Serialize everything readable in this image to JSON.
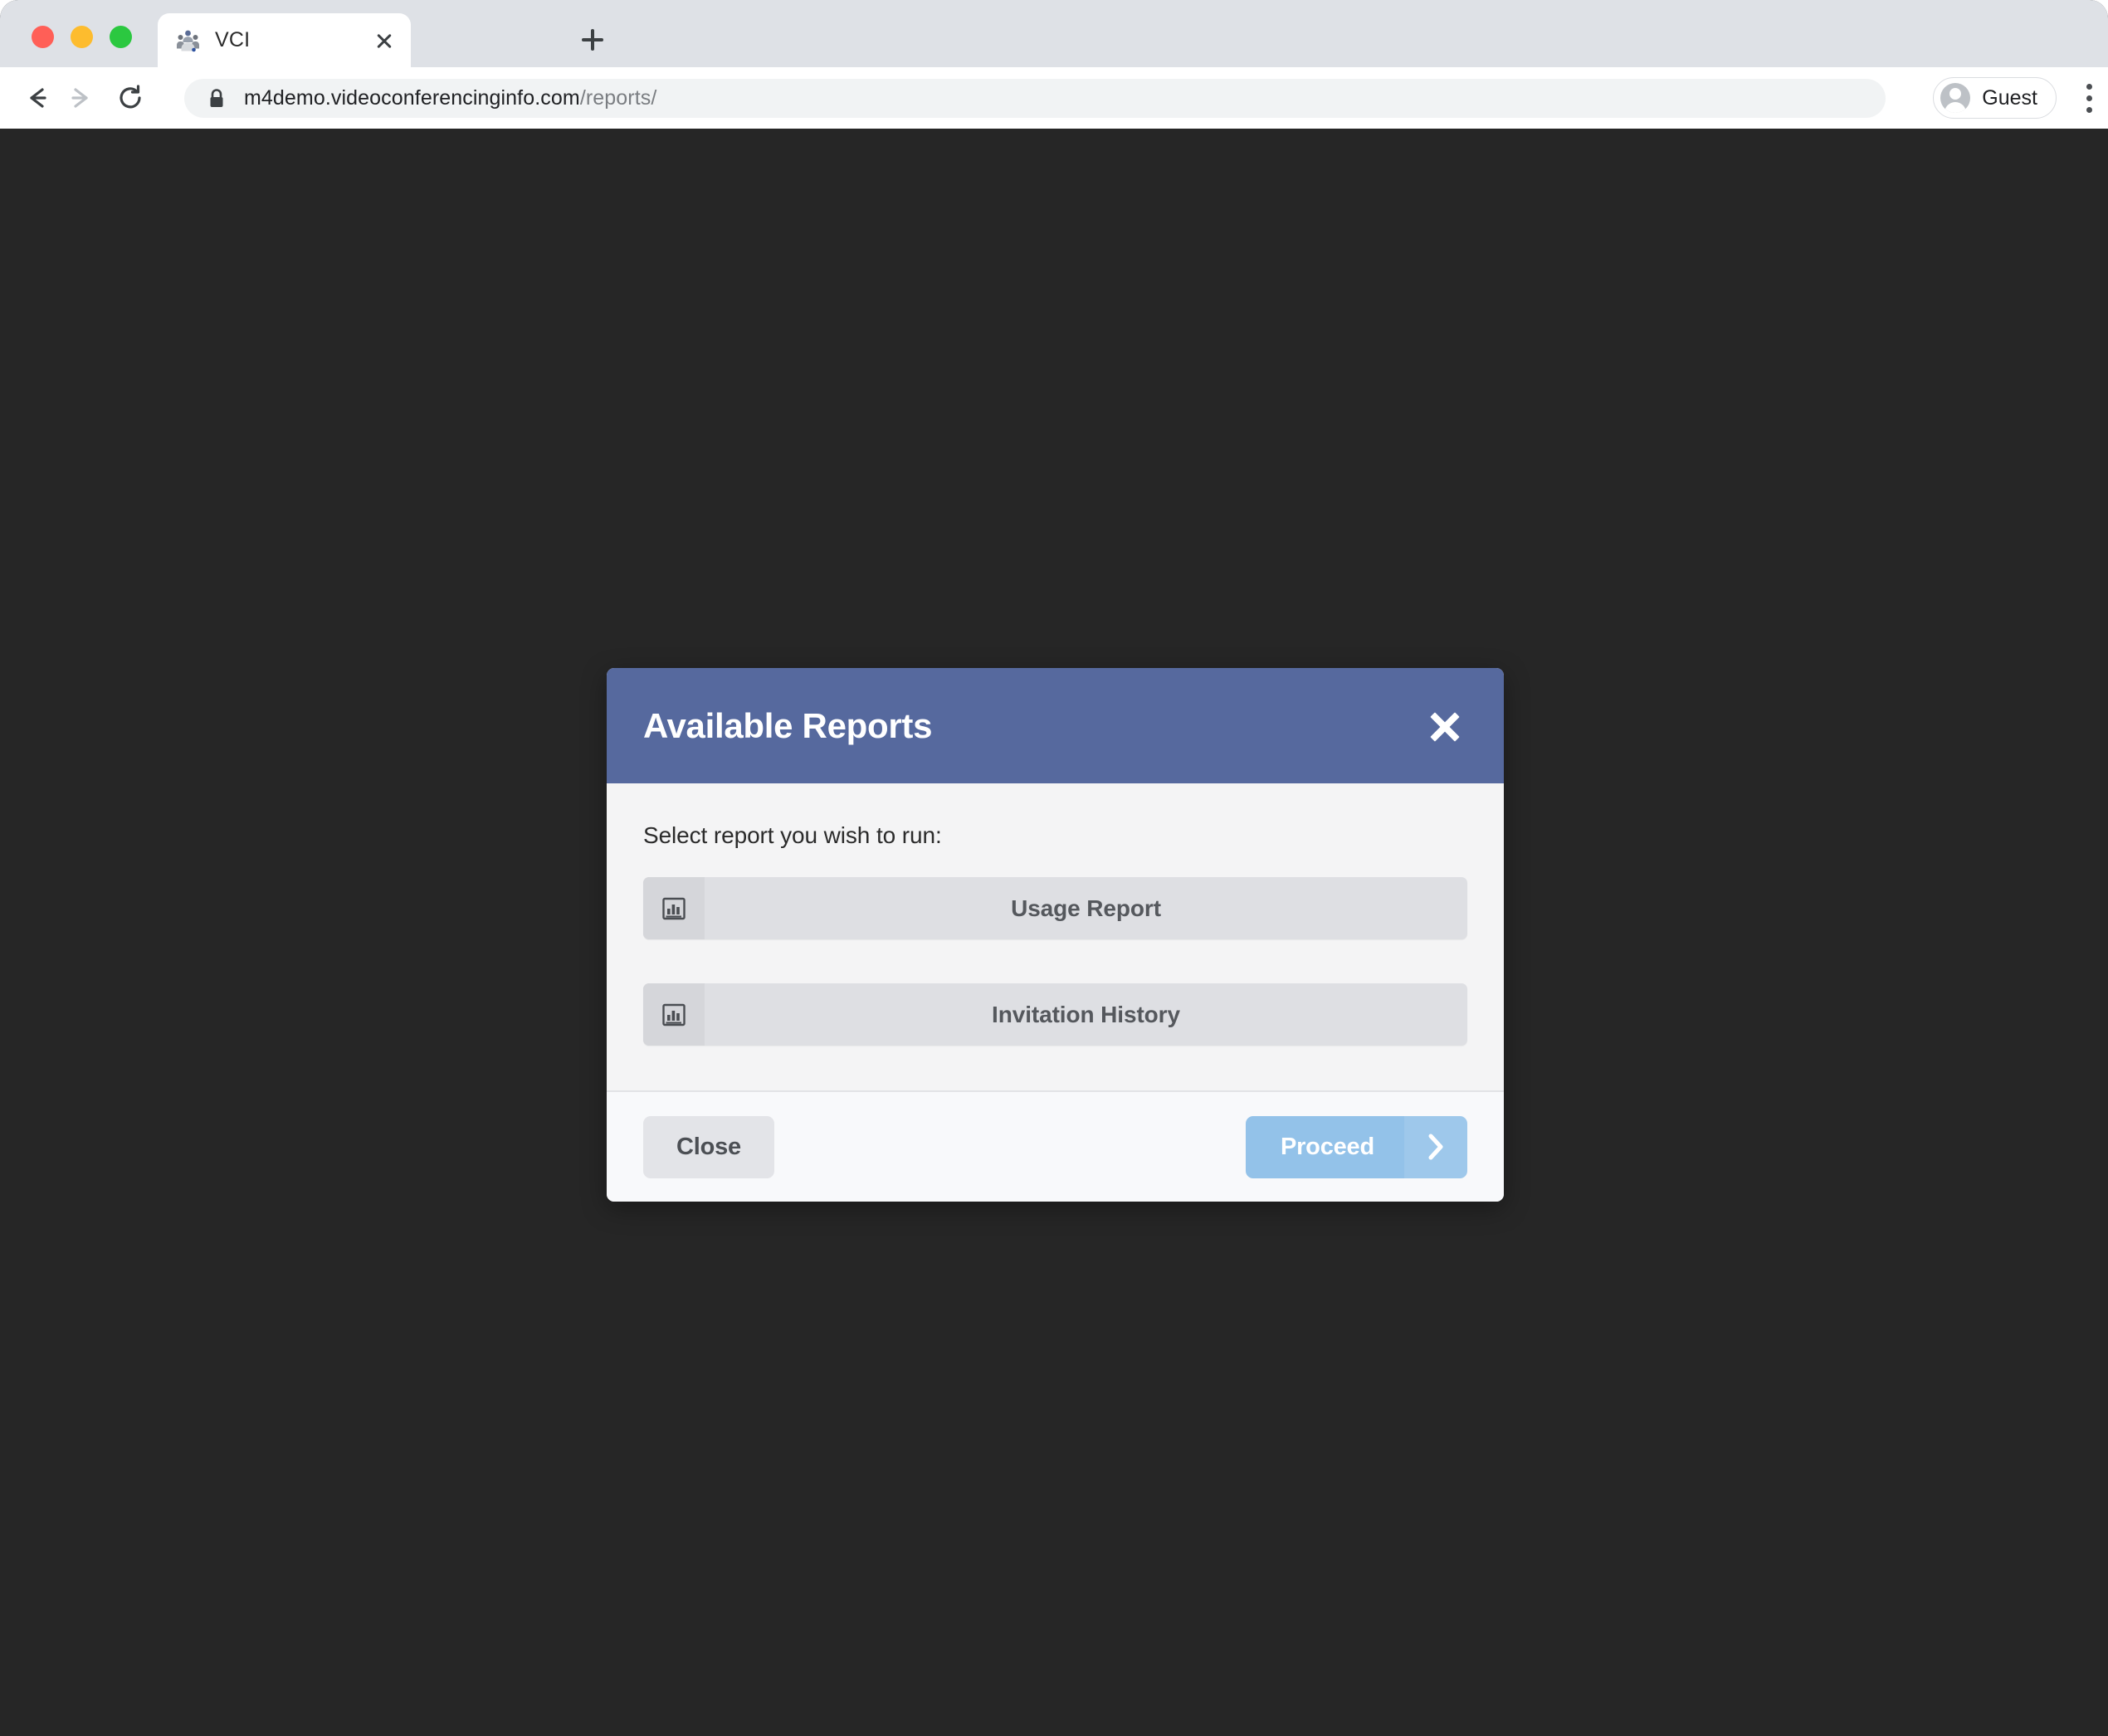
{
  "browser": {
    "tab": {
      "title": "VCI",
      "favicon": "people-group-icon",
      "close_icon": "close-icon"
    },
    "new_tab_icon": "plus-icon",
    "nav": {
      "back_icon": "arrow-left-icon",
      "forward_icon": "arrow-right-icon",
      "reload_icon": "reload-icon"
    },
    "omnibox": {
      "lock_icon": "lock-icon",
      "url_domain": "m4demo.videoconferencinginfo.com",
      "url_path": "/reports/"
    },
    "profile": {
      "name": "Guest",
      "avatar_icon": "user-avatar-icon"
    },
    "menu_icon": "kebab-menu-icon"
  },
  "modal": {
    "title": "Available Reports",
    "close_icon": "close-icon",
    "body_label": "Select report you wish to run:",
    "options": [
      {
        "label": "Usage Report",
        "icon": "bar-chart-icon"
      },
      {
        "label": "Invitation History",
        "icon": "bar-chart-icon"
      }
    ],
    "footer": {
      "close_label": "Close",
      "proceed_label": "Proceed",
      "proceed_chevron_icon": "chevron-right-icon"
    }
  },
  "colors": {
    "header_blue": "#56699E",
    "proceed_blue": "#93C2E9",
    "page_background": "#262626",
    "modal_background": "#F4F4F5",
    "option_background": "#DEDFE3"
  }
}
